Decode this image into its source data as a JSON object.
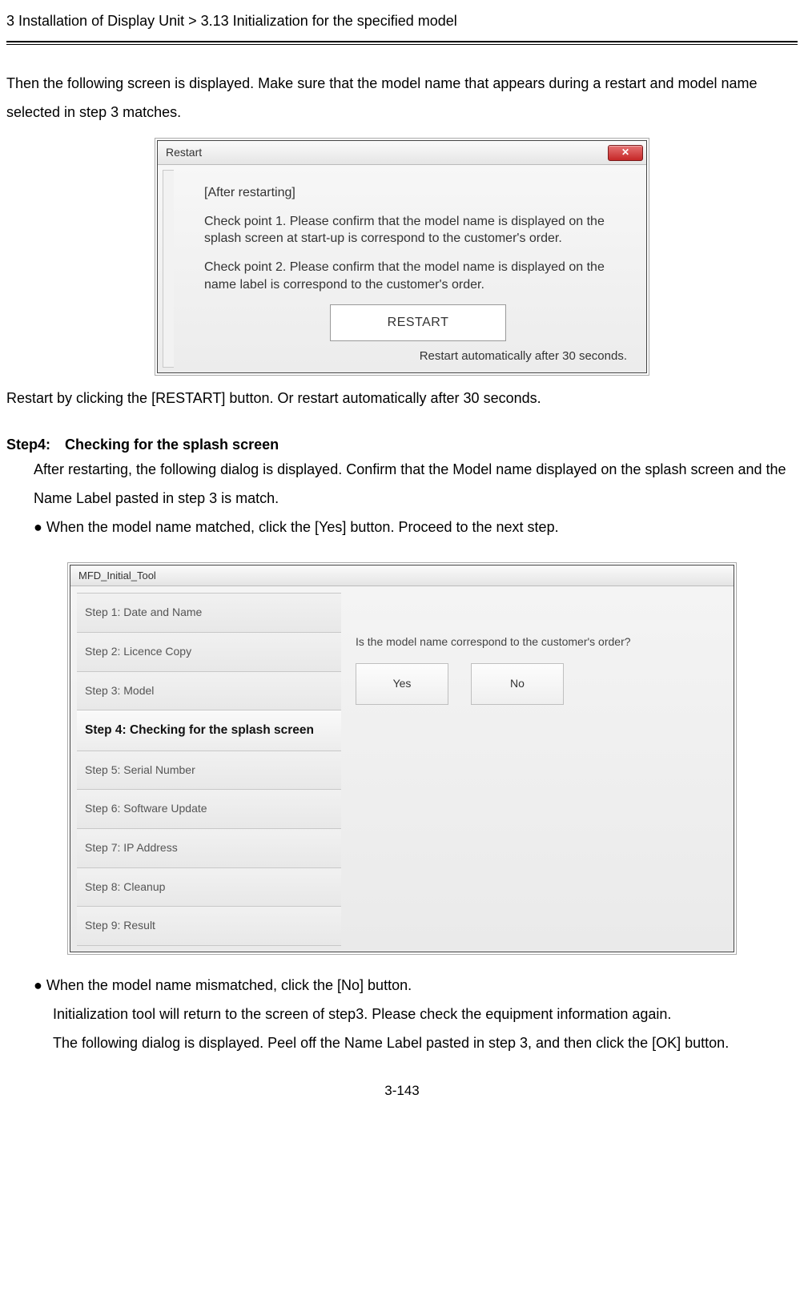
{
  "header": "3 Installation of Display Unit > 3.13 Initialization for the specified model",
  "para_intro": "Then the following screen is displayed. Make sure that the model name that appears during a restart and model name selected in step 3 matches.",
  "dialog1": {
    "title": "Restart",
    "close_glyph": "✕",
    "heading": "[After restarting]",
    "cp1": "Check point 1. Please confirm that the model name is displayed on the splash screen at start-up is correspond to the customer's order.",
    "cp2": "Check point 2. Please confirm that the model name is displayed on the name label is correspond to the customer's order.",
    "restart_label": "RESTART",
    "auto_text": "Restart automatically after 30 seconds."
  },
  "para_after_dialog1": "Restart by clicking the [RESTART] button. Or restart automatically after 30 seconds.",
  "step4": {
    "label": "Step4:",
    "title": "Checking for the splash screen",
    "p1": "After restarting, the following dialog is displayed. Confirm that the Model name displayed on the splash screen and the Name Label pasted in step 3 is match.",
    "p2": "● When the model name matched, click the [Yes] button. Proceed to the next step."
  },
  "dialog2": {
    "title": "MFD_Initial_Tool",
    "steps": [
      "Step 1: Date and Name",
      "Step 2: Licence Copy",
      "Step 3: Model",
      "Step 4: Checking for the splash screen",
      "Step 5: Serial Number",
      "Step 6: Software Update",
      "Step 7: IP Address",
      "Step 8: Cleanup",
      "Step 9: Result"
    ],
    "active_index": 3,
    "prompt": "Is the model name correspond to the customer's order?",
    "yes": "Yes",
    "no": "No"
  },
  "after": {
    "p1": "● When the model name mismatched, click the [No] button.",
    "p2": "Initialization tool will return to the screen of step3. Please check the equipment information again.",
    "p3": "The following dialog is displayed. Peel off the Name Label pasted in step 3, and then click the [OK] button."
  },
  "page_num": "3-143"
}
